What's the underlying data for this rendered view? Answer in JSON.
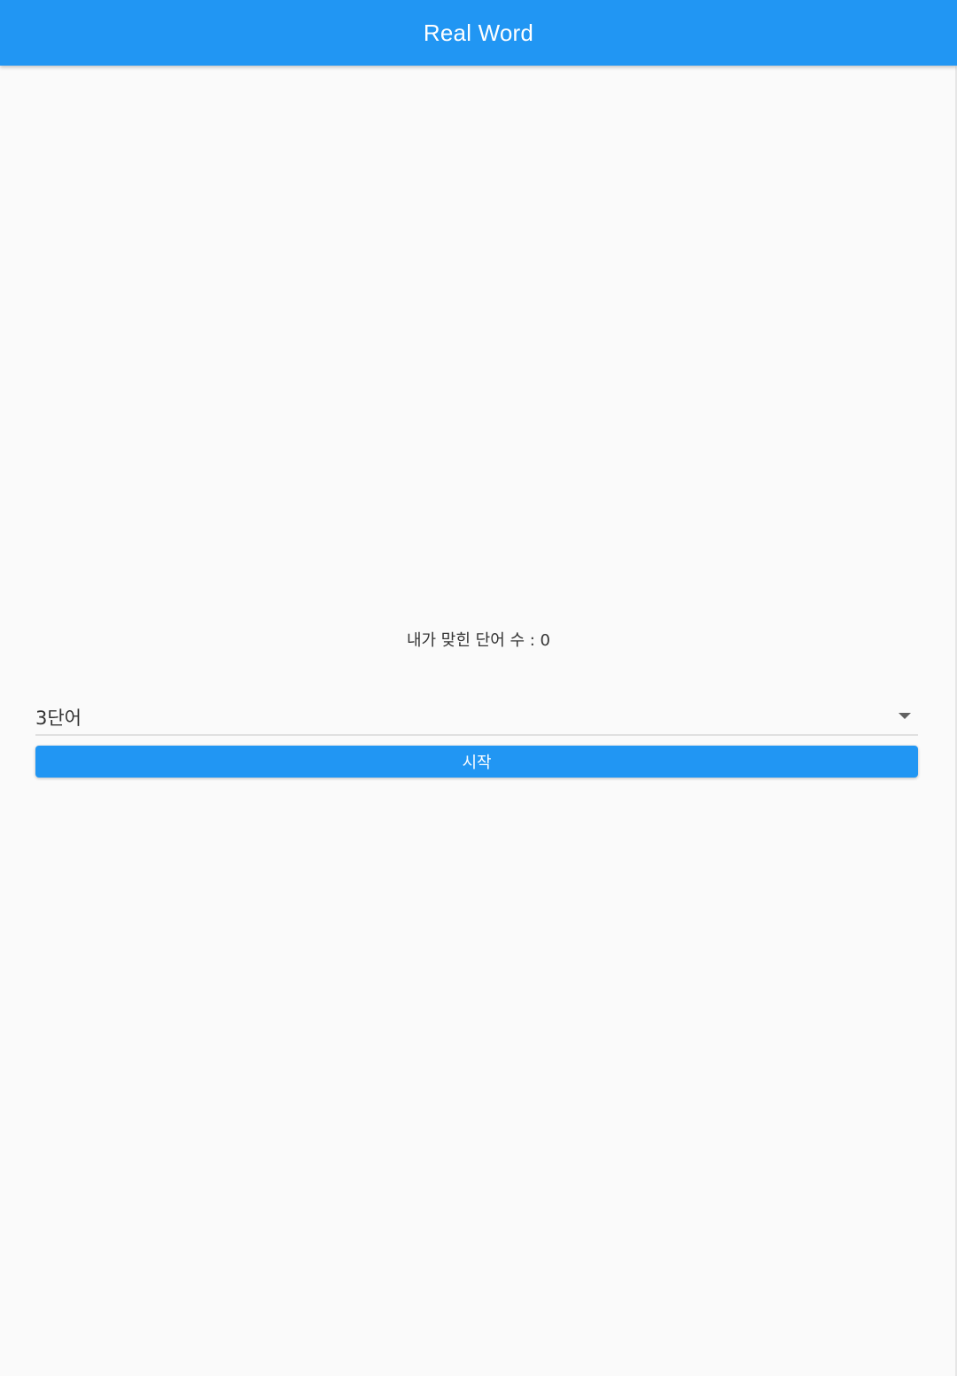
{
  "app_bar": {
    "title": "Real Word"
  },
  "main": {
    "score_text": "내가 맞힌 단어 수 : 0",
    "word_count_select": {
      "selected_value": "3단어",
      "arrow_icon": "arrow-drop-down-icon"
    },
    "start_button_label": "시작"
  },
  "colors": {
    "primary": "#2196f3",
    "background": "#fafafa",
    "text": "#333333"
  }
}
